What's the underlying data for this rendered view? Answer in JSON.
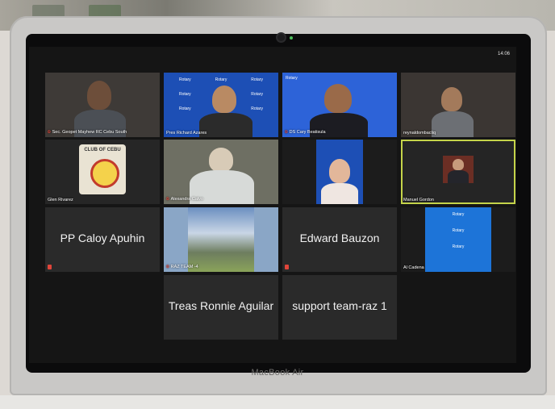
{
  "device": {
    "brand": "MacBook Air"
  },
  "zoom": {
    "clock": "14:06",
    "tiles": [
      {
        "name": "Sec. Geopet Mayhew RC Cebu South",
        "muted": true
      },
      {
        "name": "Pres Richard Azares",
        "muted": true
      },
      {
        "name": "DS Cary Beatisula",
        "muted": true
      },
      {
        "name": "reynaldombacliq",
        "muted": false
      },
      {
        "name": "Glen Rivarez",
        "muted": false
      },
      {
        "name": "Alexandra Calvo",
        "muted": true
      },
      {
        "name": "",
        "muted": false
      },
      {
        "name": "Manuel Gordon",
        "muted": false
      },
      {
        "name": "PP Caloy Apuhin",
        "muted": true
      },
      {
        "name": "RAZ TEAM -4",
        "muted": true
      },
      {
        "name": "Edward Bauzon",
        "muted": true
      },
      {
        "name": "Al Cadena",
        "muted": false
      },
      {
        "name": "Treas Ronnie Aguilar",
        "muted": false
      },
      {
        "name": "support team-raz 1",
        "muted": false
      }
    ],
    "rotary_text": "Rotary",
    "club_logo_text": "CLUB OF CEBU"
  },
  "colors": {
    "active_speaker": "#c5d44a",
    "mute": "#e0453a",
    "rotary_blue": "#1d4fb5"
  }
}
